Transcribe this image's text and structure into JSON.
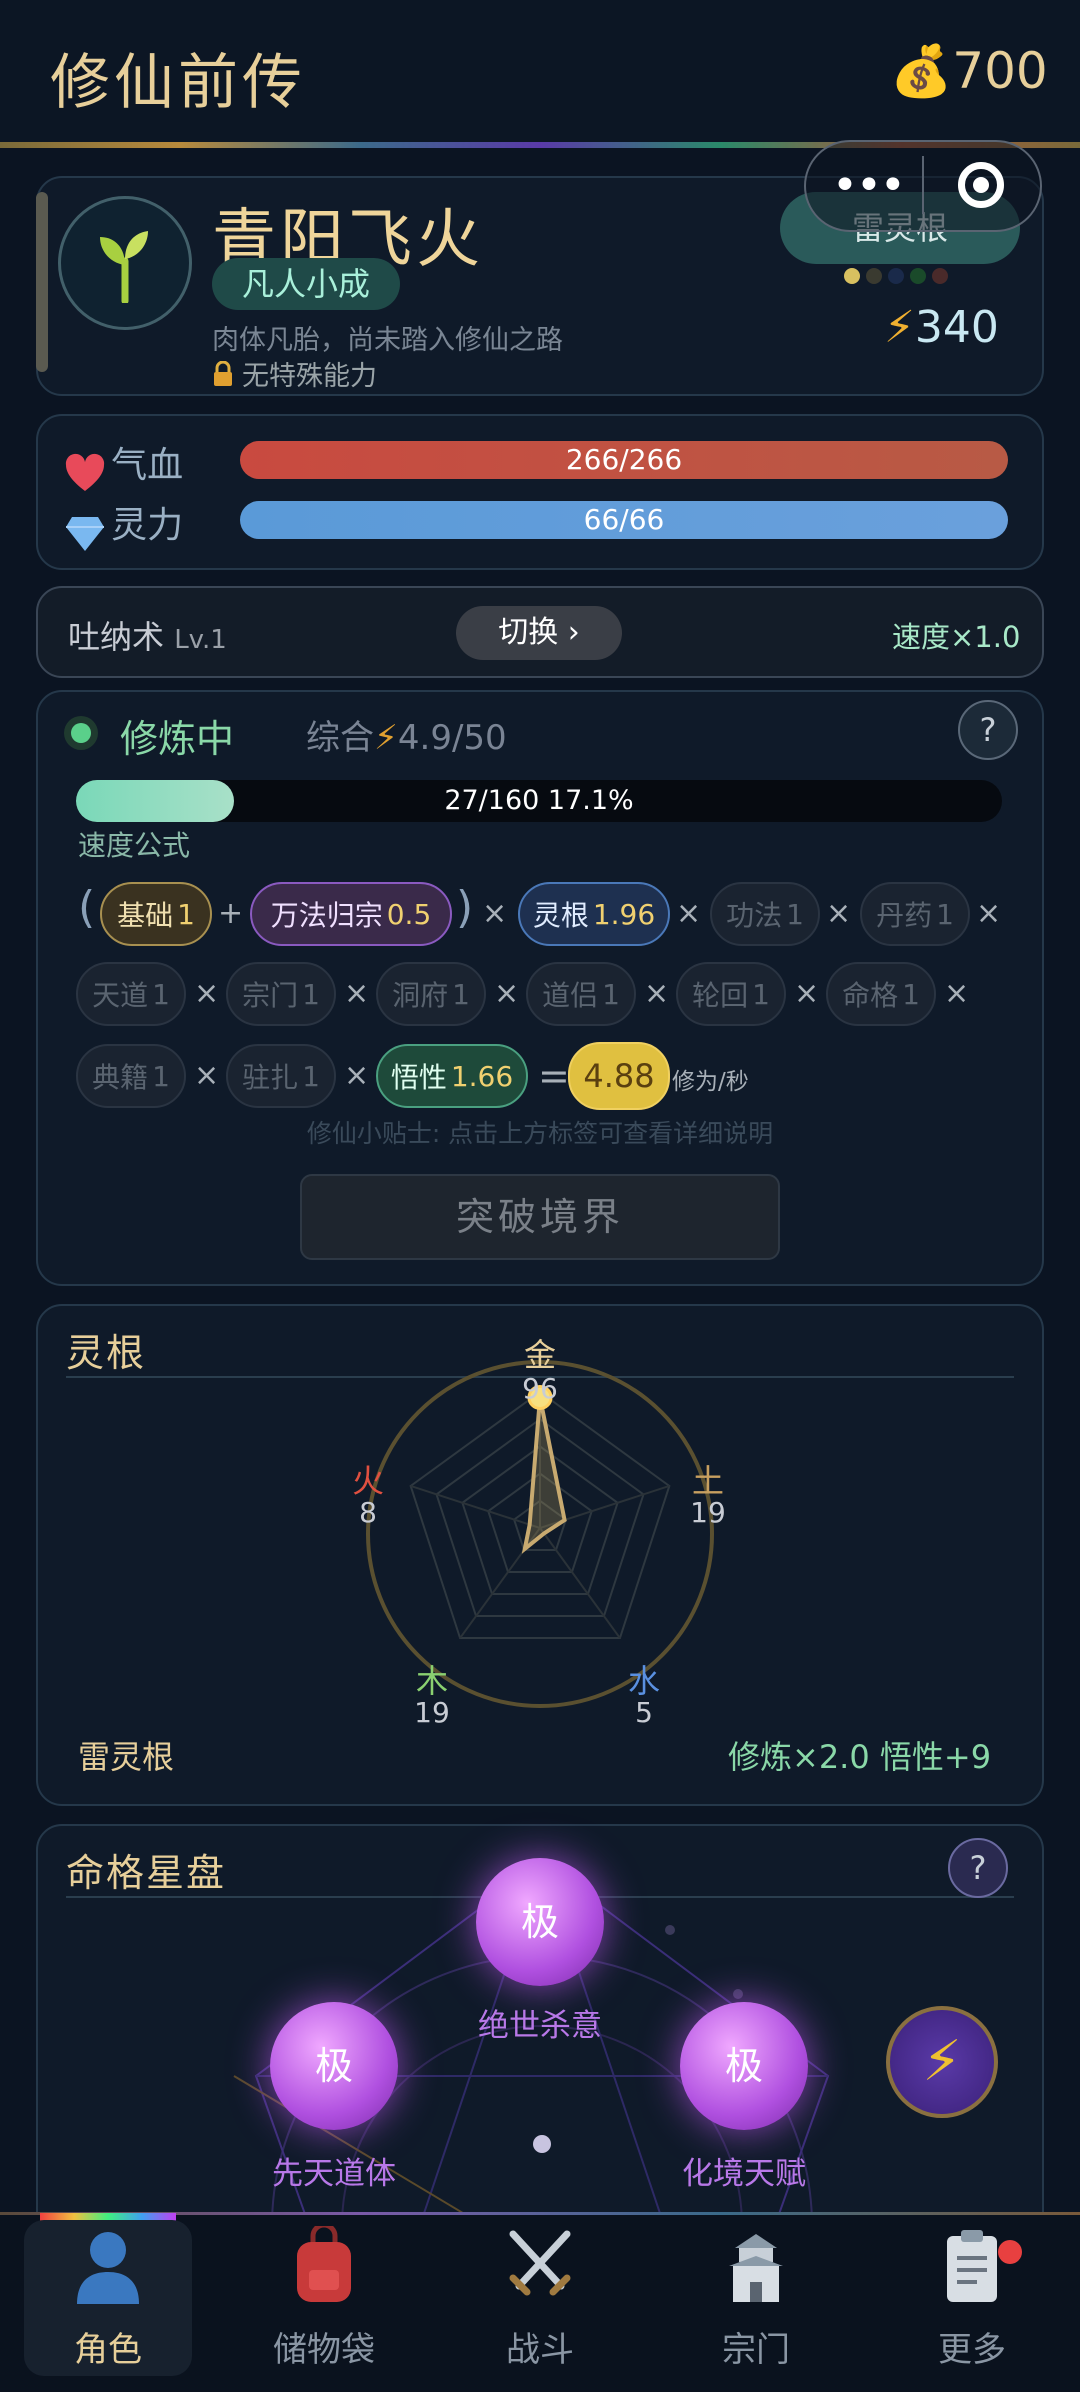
{
  "header": {
    "title": "修仙前传",
    "coins": "700",
    "coin_icon": "money-bag-icon"
  },
  "mini_program": {
    "more_label": "•••"
  },
  "character": {
    "name": "青阳飞火",
    "realm": "凡人小成",
    "description": "肉体凡胎，尚未踏入修仙之路",
    "ability": "无特殊能力",
    "root_badge": "雷灵根",
    "root_dots": [
      "#d8c060",
      "#3a3a30",
      "#1a2a4a",
      "#1a4a2a",
      "#4a2a2a"
    ],
    "power": "340"
  },
  "stats": {
    "hp_label": "气血",
    "hp_value": "266/266",
    "hp_fraction": 1.0,
    "mp_label": "灵力",
    "mp_value": "66/66",
    "mp_fraction": 1.0
  },
  "technique": {
    "name": "吐纳术",
    "level": "Lv.1",
    "switch_label": "切换 ›",
    "speed": "速度×1.0"
  },
  "training": {
    "status": "修炼中",
    "total_label": "综合",
    "total_value": "4.9/50",
    "help_label": "?",
    "progress_text": "27/160  17.1%",
    "progress_fraction": 0.171,
    "formula_label": "速度公式",
    "chips": {
      "base": {
        "name": "基础",
        "value": "1"
      },
      "wanfa": {
        "name": "万法归宗",
        "value": "0.5"
      },
      "linggen": {
        "name": "灵根",
        "value": "1.96"
      },
      "gongfa": {
        "name": "功法",
        "value": "1"
      },
      "danyao": {
        "name": "丹药",
        "value": "1"
      },
      "tiandao": {
        "name": "天道",
        "value": "1"
      },
      "zongmen": {
        "name": "宗门",
        "value": "1"
      },
      "dongfu": {
        "name": "洞府",
        "value": "1"
      },
      "daolv": {
        "name": "道侣",
        "value": "1"
      },
      "lunhui": {
        "name": "轮回",
        "value": "1"
      },
      "mingge": {
        "name": "命格",
        "value": "1"
      },
      "dianji": {
        "name": "典籍",
        "value": "1"
      },
      "zhuzha": {
        "name": "驻扎",
        "value": "1"
      },
      "wuxing": {
        "name": "悟性",
        "value": "1.66"
      },
      "result": "4.88"
    },
    "unit": "修为/秒",
    "tip": "修仙小贴士: 点击上方标签可查看详细说明",
    "breakthrough_label": "突破境界"
  },
  "spirit_root": {
    "title": "灵根",
    "elements": [
      {
        "name": "金",
        "value": "96",
        "color": "#e7cf9a"
      },
      {
        "name": "土",
        "value": "19",
        "color": "#c8a060"
      },
      {
        "name": "水",
        "value": "5",
        "color": "#5a90e0"
      },
      {
        "name": "木",
        "value": "19",
        "color": "#8ad070"
      },
      {
        "name": "火",
        "value": "8",
        "color": "#e05040"
      }
    ],
    "max_value": 100,
    "root_name": "雷灵根",
    "bonus": "修炼×2.0  悟性+9"
  },
  "star_plate": {
    "title": "命格星盘",
    "help_label": "?",
    "orbs": [
      {
        "symbol": "极",
        "label": "绝世杀意"
      },
      {
        "symbol": "极",
        "label": "先天道体"
      },
      {
        "symbol": "极",
        "label": "化境天赋"
      }
    ]
  },
  "nav": [
    {
      "label": "角色",
      "icon": "person-icon"
    },
    {
      "label": "储物袋",
      "icon": "backpack-icon"
    },
    {
      "label": "战斗",
      "icon": "crossed-swords-icon"
    },
    {
      "label": "宗门",
      "icon": "castle-icon"
    },
    {
      "label": "更多",
      "icon": "clipboard-icon"
    }
  ]
}
